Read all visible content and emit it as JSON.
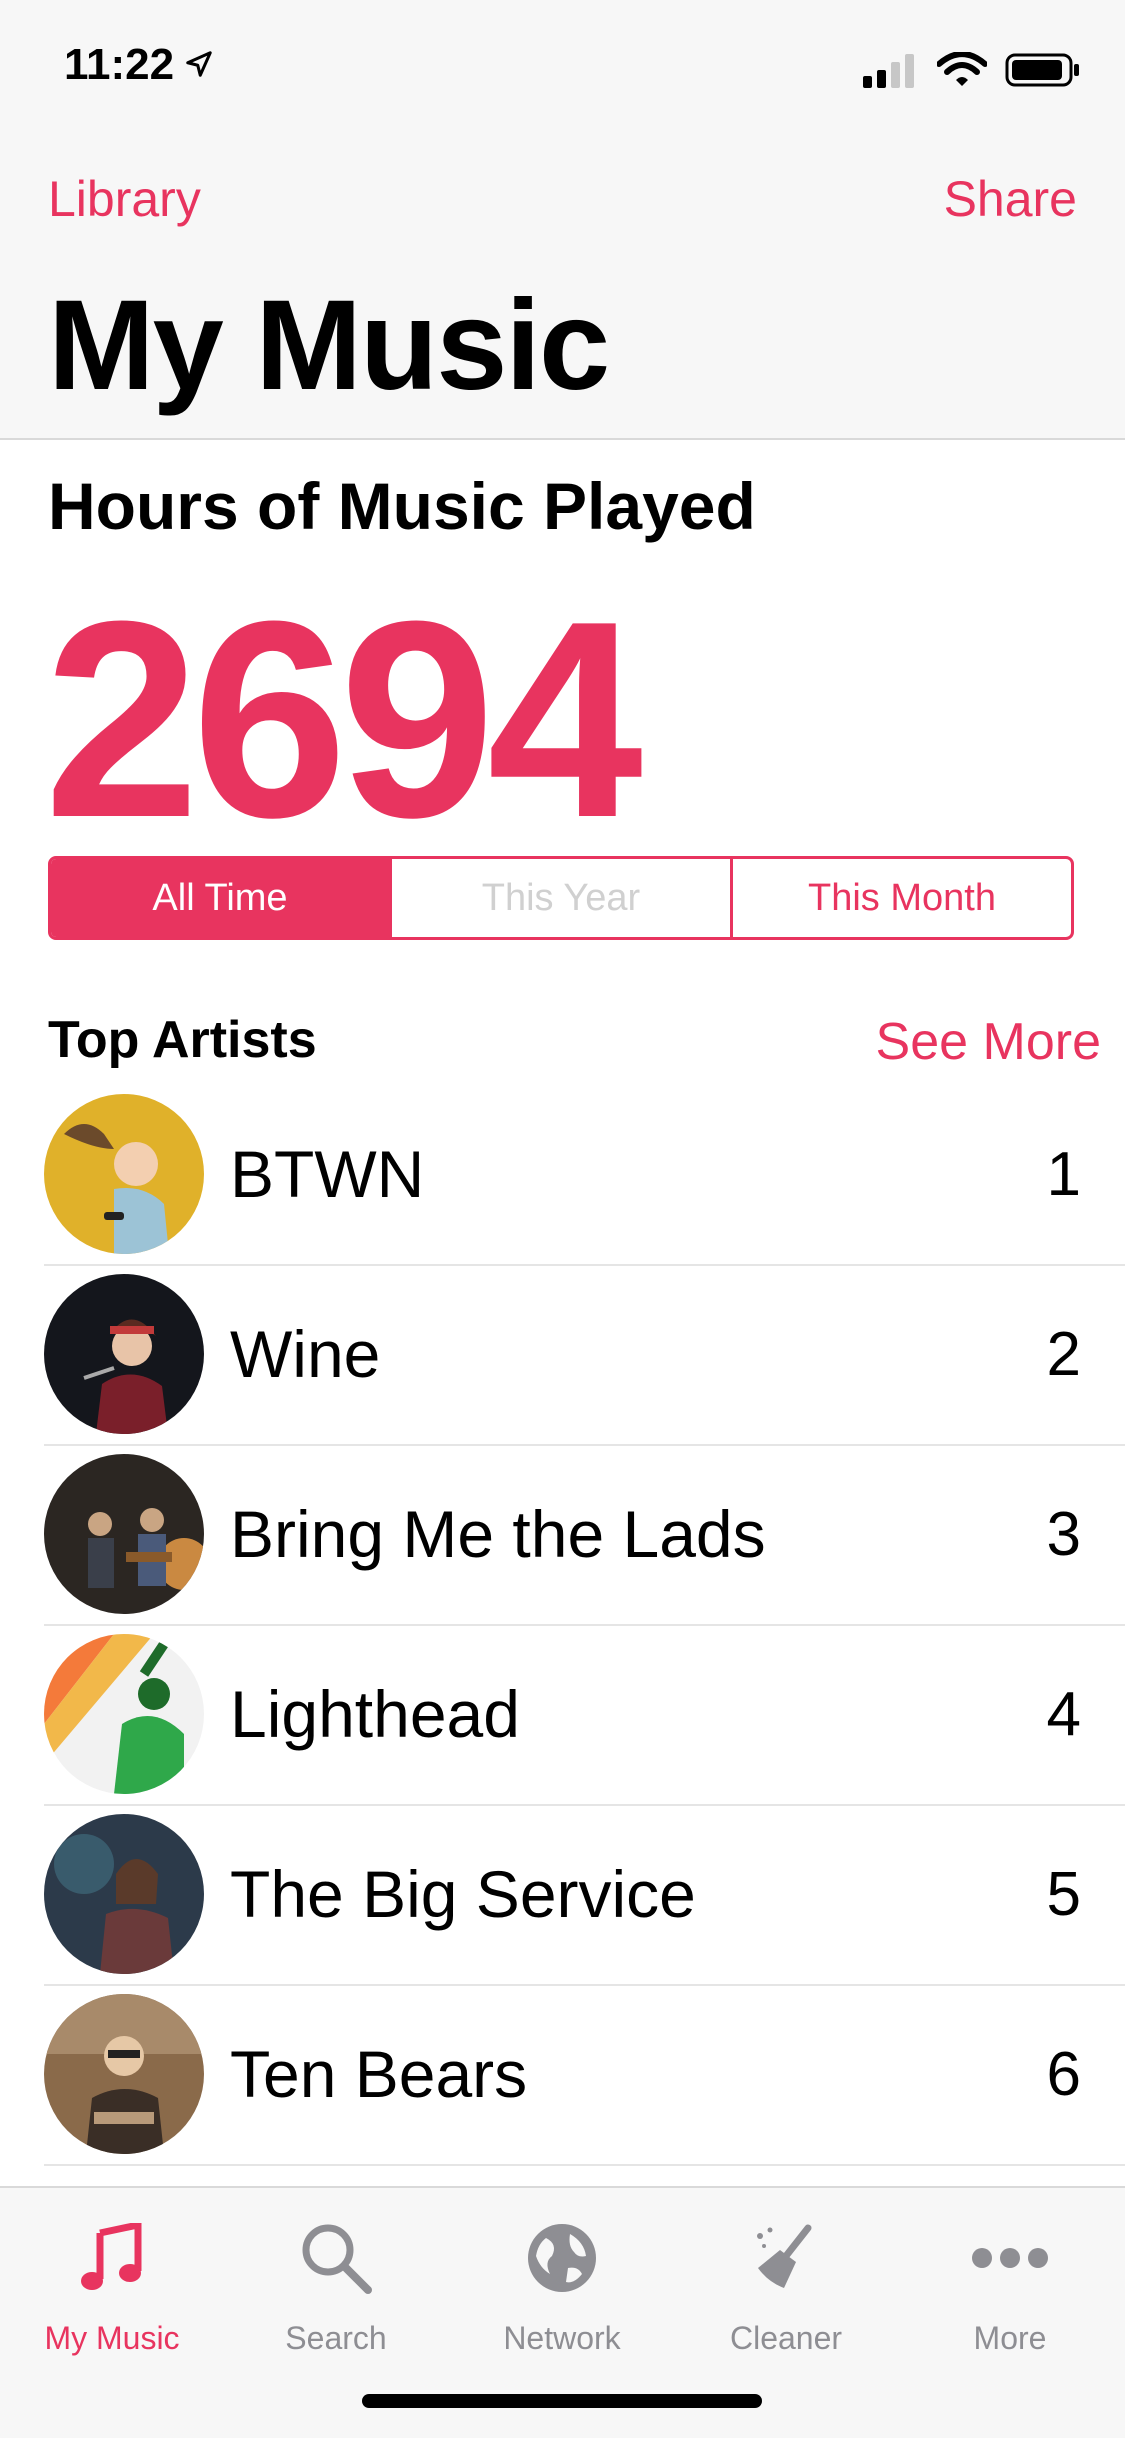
{
  "status": {
    "time": "11:22"
  },
  "nav": {
    "left": "Library",
    "right": "Share"
  },
  "title": "My Music",
  "stats": {
    "title": "Hours of Music Played",
    "number": "2694",
    "segments": [
      "All Time",
      "This Year",
      "This Month"
    ],
    "selected": "All Time"
  },
  "top_artists": {
    "title": "Top Artists",
    "see_more": "See More",
    "items": [
      {
        "name": "BTWN",
        "rank": "1"
      },
      {
        "name": "Wine",
        "rank": "2"
      },
      {
        "name": "Bring Me the Lads",
        "rank": "3"
      },
      {
        "name": "Lighthead",
        "rank": "4"
      },
      {
        "name": "The Big Service",
        "rank": "5"
      },
      {
        "name": "Ten Bears",
        "rank": "6"
      }
    ]
  },
  "tabs": [
    {
      "label": "My Music",
      "icon": "music-note-icon"
    },
    {
      "label": "Search",
      "icon": "search-icon"
    },
    {
      "label": "Network",
      "icon": "globe-icon"
    },
    {
      "label": "Cleaner",
      "icon": "broom-icon"
    },
    {
      "label": "More",
      "icon": "more-icon"
    }
  ],
  "colors": {
    "accent": "#e8345f",
    "tab_inactive": "#8e8e93"
  }
}
